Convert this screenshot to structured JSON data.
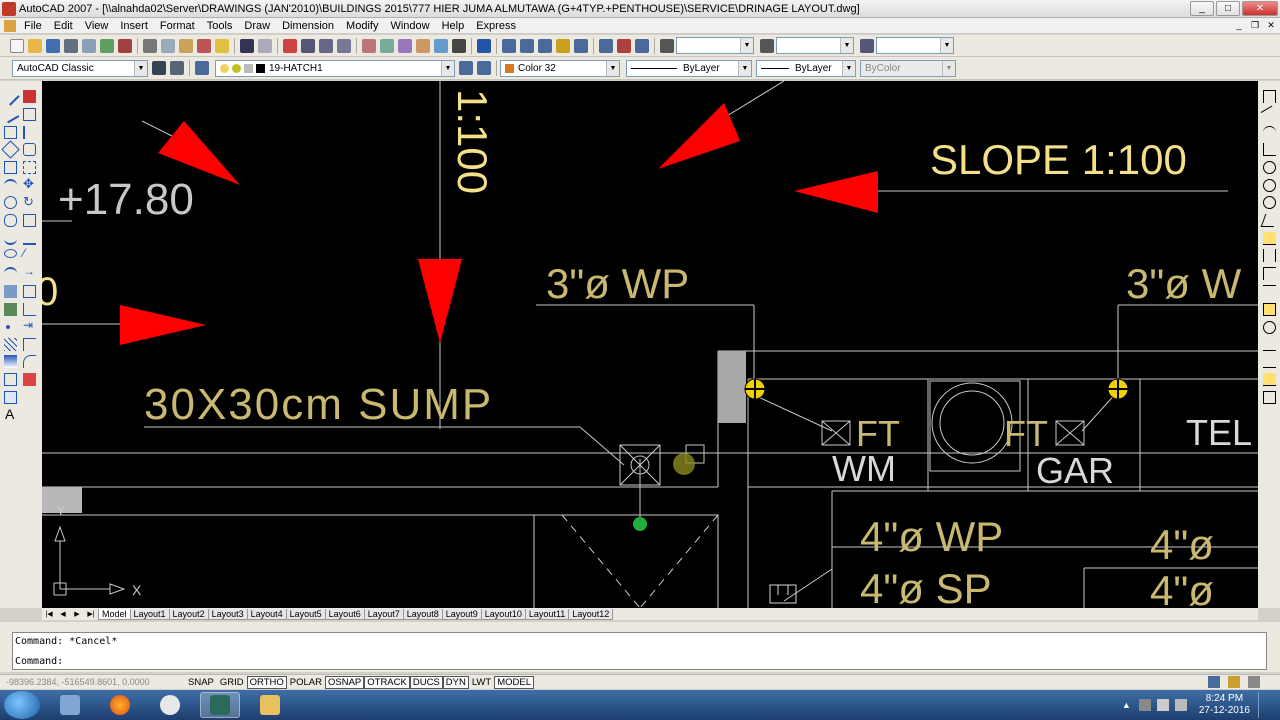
{
  "window": {
    "title": "AutoCAD 2007 - [\\\\alnahda02\\Server\\DRAWINGS (JAN'2010)\\BUILDINGS 2015\\777 HIER JUMA ALMUTAWA (G+4TYP.+PENTHOUSE)\\SERVICE\\DRINAGE LAYOUT.dwg]",
    "minimize": "_",
    "maximize": "□",
    "close": "✕"
  },
  "menu": {
    "items": [
      "File",
      "Edit",
      "View",
      "Insert",
      "Format",
      "Tools",
      "Draw",
      "Dimension",
      "Modify",
      "Window",
      "Help",
      "Express"
    ]
  },
  "toolbar2": {
    "workspace": "AutoCAD Classic",
    "layer": "19-HATCH1",
    "color": "Color 32",
    "linetype": "ByLayer",
    "lineweight": "ByLayer",
    "plotstyle": "ByColor"
  },
  "drawing": {
    "labels": {
      "elev": "+17.80",
      "zero": "0",
      "slope_vertical": "1:100",
      "slope": "SLOPE 1:100",
      "wp3_left": "3\"ø  WP",
      "wp3_right": "3\"ø  W",
      "sump": "30X30cm  SUMP",
      "ft1": "FT",
      "ft2": "FT",
      "wm": "WM",
      "gar": "GAR",
      "tel": "TEL",
      "wp4": "4\"ø  WP",
      "sp4": "4\"ø  SP",
      "wp4_right": "4\"ø",
      "sp4_right": "4\"ø",
      "ucs_x": "X",
      "ucs_y": "Y"
    },
    "colors": {
      "background": "#000000",
      "text_yellow": "#f5e08a",
      "text_white": "#d8d8d8",
      "arrow_red": "#ff0000",
      "line": "#c8c8c8"
    }
  },
  "tabs": {
    "items": [
      "Model",
      "Layout1",
      "Layout2",
      "Layout3",
      "Layout4",
      "Layout5",
      "Layout6",
      "Layout7",
      "Layout8",
      "Layout9",
      "Layout10",
      "Layout11",
      "Layout12"
    ]
  },
  "command": {
    "history": "Command: *Cancel*",
    "prompt": "Command:"
  },
  "status": {
    "coords": "-98396.2384, -516549.8601, 0.0000",
    "buttons": [
      "SNAP",
      "GRID",
      "ORTHO",
      "POLAR",
      "OSNAP",
      "OTRACK",
      "DUCS",
      "DYN",
      "LWT",
      "MODEL"
    ]
  },
  "taskbar": {
    "time": "8:24 PM",
    "date": "27-12-2016"
  }
}
